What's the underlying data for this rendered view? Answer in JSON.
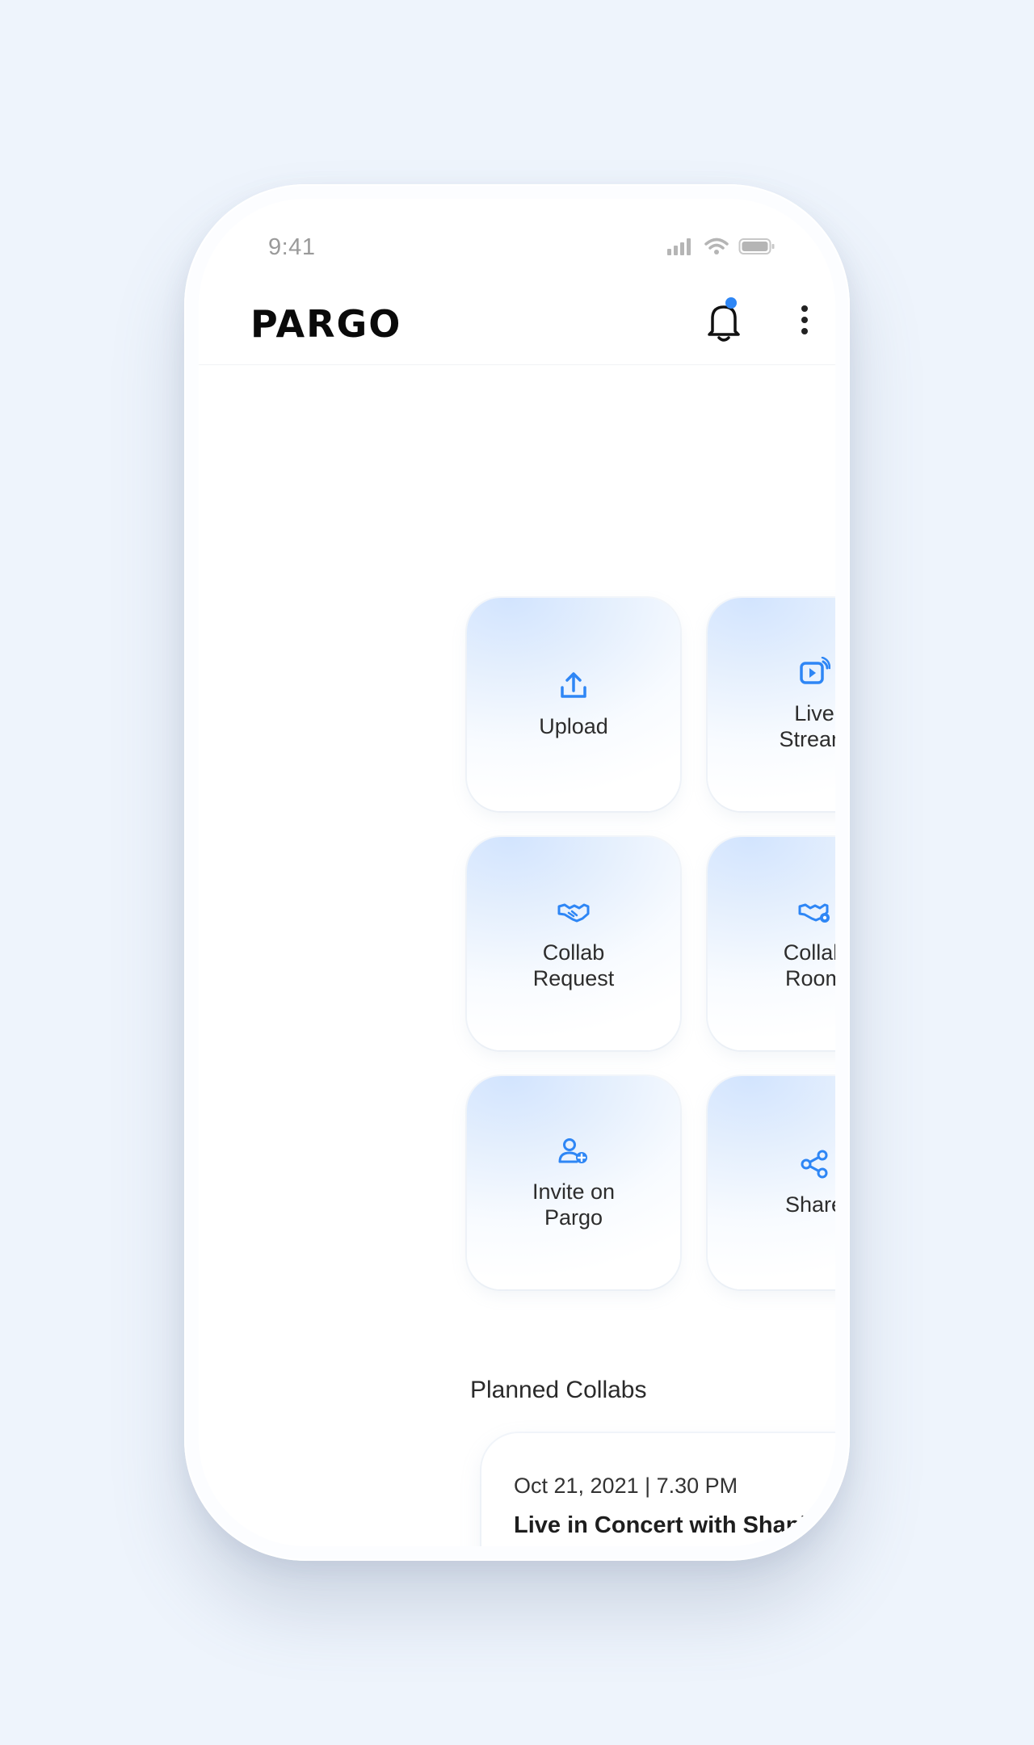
{
  "status_bar": {
    "time": "9:41"
  },
  "header": {
    "logo": "PARGO"
  },
  "actions": [
    {
      "label": "Upload",
      "icon": "upload-icon"
    },
    {
      "label": "Live\nStream",
      "icon": "live-stream-icon"
    },
    {
      "label": "Collab\nRequest",
      "icon": "handshake-icon"
    },
    {
      "label": "Collab\nRoom",
      "icon": "handshake-settings-icon"
    },
    {
      "label": "Invite on\nPargo",
      "icon": "add-user-icon"
    },
    {
      "label": "Share",
      "icon": "share-icon"
    }
  ],
  "planned_collabs": {
    "title": "Planned Collabs",
    "items": [
      {
        "date": "Oct 21, 2021 | 7.30 PM",
        "title": "Live in Concert with Shankar..."
      }
    ]
  },
  "bottom_nav": [
    "home-icon",
    "search-icon",
    "plus-icon",
    "chat-icon",
    "profile-avatar"
  ],
  "colors": {
    "accent": "#2e86f5",
    "text": "#2d2d2d",
    "background": "#eef4fc"
  }
}
